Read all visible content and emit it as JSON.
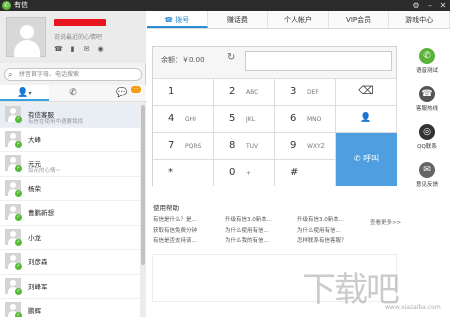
{
  "app": {
    "title": "有信",
    "logo_glyph": "✆"
  },
  "window_controls": {
    "settings": "⚙",
    "minimize": "–",
    "close": "✕"
  },
  "profile": {
    "signature": "说说最近的心情吧",
    "status_icons": [
      "phone-icon",
      "mobile-icon",
      "mail-icon",
      "game-icon"
    ],
    "status_glyphs": [
      "☎",
      "▮",
      "✉",
      "◉"
    ]
  },
  "search": {
    "placeholder": "拼音首字母、电话搜索",
    "icon": "⌕"
  },
  "left_tabs": [
    {
      "glyph": "👤",
      "arrow": "▾",
      "name": "contacts"
    },
    {
      "glyph": "✆",
      "name": "call-log"
    },
    {
      "glyph": "💬",
      "badge": "···",
      "name": "messages"
    }
  ],
  "contacts": [
    {
      "name": "有信客服",
      "status": "有信在使用中遇要我找"
    },
    {
      "name": "大峰",
      "status": ""
    },
    {
      "name": "元元",
      "status": "如花的心情~"
    },
    {
      "name": "杨荣",
      "status": ""
    },
    {
      "name": "曹鹏新想",
      "status": ""
    },
    {
      "name": "小龙",
      "status": ""
    },
    {
      "name": "刘彦森",
      "status": ""
    },
    {
      "name": "刘峰军",
      "status": ""
    },
    {
      "name": "鹏辉",
      "status": ""
    }
  ],
  "tabs": [
    {
      "label": "拨号",
      "icon": "☎",
      "active": true
    },
    {
      "label": "赚话费"
    },
    {
      "label": "个人帐户"
    },
    {
      "label": "VIP会员"
    },
    {
      "label": "游戏中心"
    }
  ],
  "dialer": {
    "balance_label": "余额：￥0.00",
    "refresh_icon": "↻",
    "keys": [
      {
        "num": "1",
        "letters": ""
      },
      {
        "num": "2",
        "letters": "ABC"
      },
      {
        "num": "3",
        "letters": "DEF"
      },
      {
        "num": "4",
        "letters": "GHI"
      },
      {
        "num": "5",
        "letters": "JKL"
      },
      {
        "num": "6",
        "letters": "MNO"
      },
      {
        "num": "7",
        "letters": "PQRS"
      },
      {
        "num": "8",
        "letters": "TUV"
      },
      {
        "num": "9",
        "letters": "WXYZ"
      },
      {
        "num": "*",
        "letters": ""
      },
      {
        "num": "0",
        "letters": "+"
      },
      {
        "num": "#",
        "letters": ""
      }
    ],
    "backspace_glyph": "⌫",
    "add_contact_glyph": "👤",
    "call_label": "呼叫",
    "call_glyph": "✆"
  },
  "help": {
    "title": "使用帮助",
    "links": [
      "有信是什么？是...",
      "升级有信3.0新本...",
      "升级有信3.0新本...",
      "获取有信免费分钟",
      "为什么使用有信...",
      "为什么使用有信...",
      "有信是否支持该...",
      "为什么我的有信...",
      "怎样联系有信客服？"
    ],
    "more": "查看更多>>"
  },
  "right_side": [
    {
      "label": "语音测试",
      "glyph": "✆",
      "color": "#5cb13a"
    },
    {
      "label": "客服热线",
      "glyph": "☎",
      "color": "#555555"
    },
    {
      "label": "QQ联系",
      "glyph": "◎",
      "color": "#333333"
    },
    {
      "label": "意见反馈",
      "glyph": "✉",
      "color": "#666666"
    }
  ],
  "watermark": {
    "main": "下载吧",
    "sub": "www.xiazaiba.com"
  }
}
